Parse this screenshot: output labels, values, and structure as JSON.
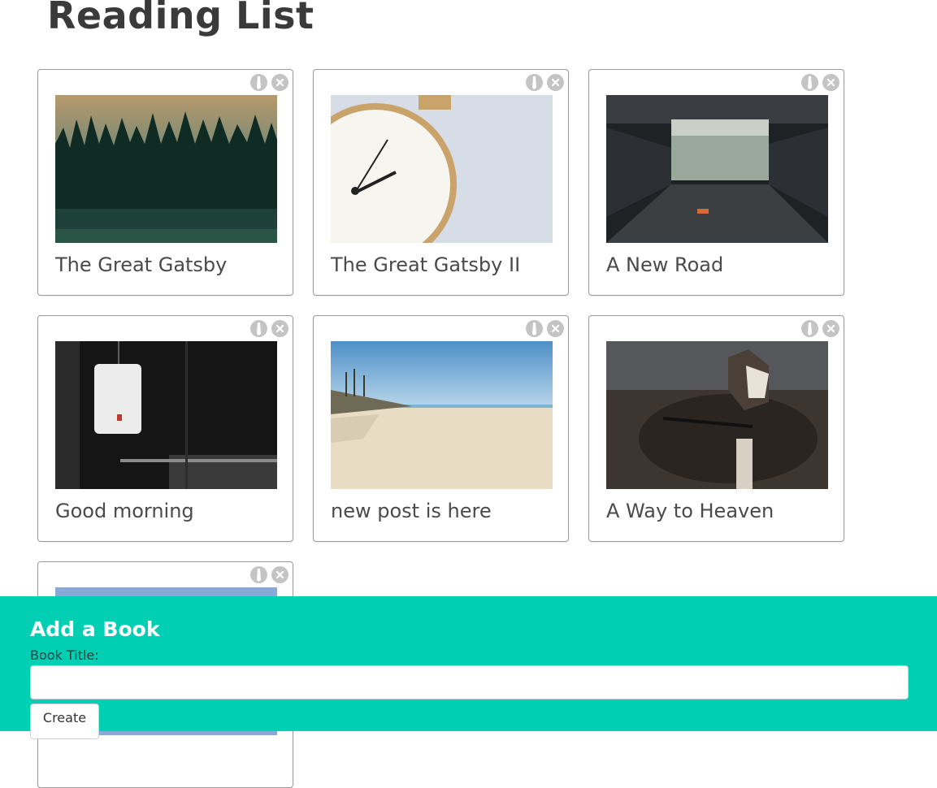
{
  "page": {
    "title": "Reading List"
  },
  "books": [
    {
      "title": "The Great Gatsby",
      "image": "forest-at-dusk"
    },
    {
      "title": "The Great Gatsby II",
      "image": "alarm-clock"
    },
    {
      "title": "A New Road",
      "image": "underpass-road"
    },
    {
      "title": "Good morning",
      "image": "paper-lantern"
    },
    {
      "title": "new post is here",
      "image": "sandy-beach"
    },
    {
      "title": "A Way to Heaven",
      "image": "husky-dog"
    },
    {
      "title": "",
      "image": "sky"
    }
  ],
  "card_actions": {
    "edit_icon": "pencil-icon",
    "delete_icon": "close-circle-icon"
  },
  "add_form": {
    "heading": "Add a Book",
    "label": "Book Title:",
    "input_value": "",
    "input_placeholder": "",
    "submit_label": "Create"
  },
  "colors": {
    "panel": "#00cfb4",
    "icon_bg": "#c4c4c4",
    "card_border": "#9a9a9a"
  }
}
